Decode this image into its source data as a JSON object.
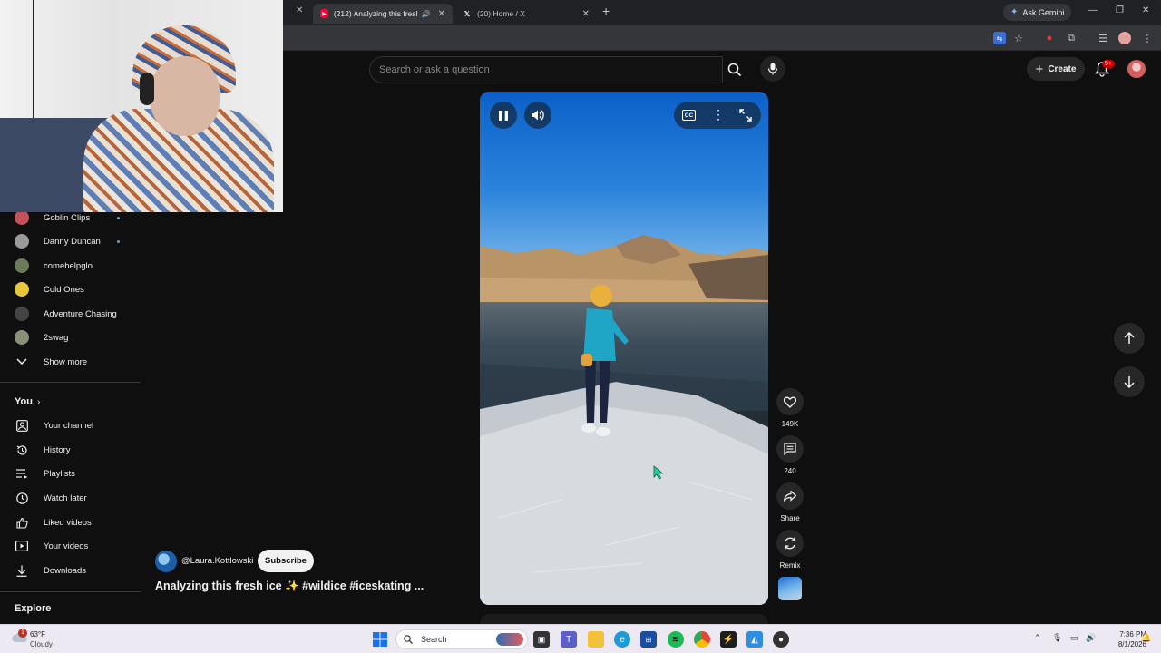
{
  "browser": {
    "tabs": [
      {
        "title": "(212) Analyzing this fresh ic",
        "favicon": "youtube-icon",
        "active": true
      },
      {
        "title": "(20) Home / X",
        "favicon": "x-icon",
        "active": false
      }
    ],
    "ask_gemini": "Ask Gemini",
    "new_tab_symbol": "+"
  },
  "youtube": {
    "search_placeholder": "Search or ask a question",
    "create_label": "Create",
    "notifications_badge": "9+"
  },
  "sidebar": {
    "subscriptions": [
      {
        "name": "Goblin Clips",
        "new": true,
        "color": "#c4525a"
      },
      {
        "name": "Danny Duncan",
        "new": true,
        "color": "#9a9a9a"
      },
      {
        "name": "comehelpglo",
        "new": false,
        "color": "#6c7a5a"
      },
      {
        "name": "Cold Ones",
        "new": false,
        "color": "#e8c63a"
      },
      {
        "name": "Adventure Chasing",
        "new": false,
        "color": "#444444"
      },
      {
        "name": "2swag",
        "new": false,
        "color": "#8a8f7a"
      }
    ],
    "show_more": "Show more",
    "you_section": {
      "title": "You",
      "items": [
        "Your channel",
        "History",
        "Playlists",
        "Watch later",
        "Liked videos",
        "Your videos",
        "Downloads"
      ]
    },
    "explore_title": "Explore"
  },
  "short": {
    "channel": "@Laura.Kottlowski",
    "subscribe": "Subscribe",
    "title": "Analyzing this fresh ice ✨ #wildice #iceskating ...",
    "likes": "149K",
    "comments": "240",
    "share": "Share",
    "remix": "Remix"
  },
  "taskbar": {
    "temperature": "63°F",
    "condition": "Cloudy",
    "weather_alert": "1",
    "search_label": "Search",
    "time": "7:36 PM",
    "date": "8/1/2026"
  }
}
